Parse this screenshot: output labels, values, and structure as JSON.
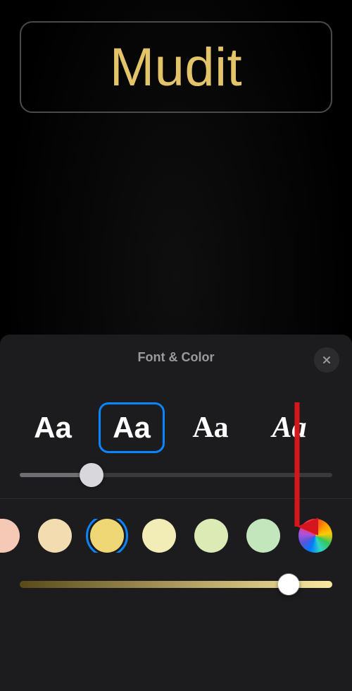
{
  "editor": {
    "name_text": "Mudit",
    "text_color": "#e3c469"
  },
  "sheet": {
    "title": "Font & Color",
    "close_icon": "close-icon"
  },
  "fonts": {
    "sample": "Aa",
    "options": [
      {
        "id": "font-heavy",
        "selected": false
      },
      {
        "id": "font-bold",
        "selected": true
      },
      {
        "id": "font-serif",
        "selected": false
      },
      {
        "id": "font-serif-italic",
        "selected": false
      }
    ]
  },
  "size_slider": {
    "value_pct": 23
  },
  "colors": {
    "swatches": [
      {
        "hex": "#f6c9b7",
        "partial": true,
        "selected": false
      },
      {
        "hex": "#f3dcb0",
        "partial": false,
        "selected": false
      },
      {
        "hex": "#f0d775",
        "partial": false,
        "selected": true
      },
      {
        "hex": "#f2edb7",
        "partial": false,
        "selected": false
      },
      {
        "hex": "#dcebb6",
        "partial": false,
        "selected": false
      },
      {
        "hex": "#c3e6bc",
        "partial": false,
        "selected": false
      }
    ],
    "picker_icon": "color-wheel-icon"
  },
  "brightness": {
    "gradient_from": "#5a4a1a",
    "gradient_to": "#f9e9a0",
    "value_pct": 86
  },
  "annotation": {
    "arrow_color": "#d4171c"
  }
}
